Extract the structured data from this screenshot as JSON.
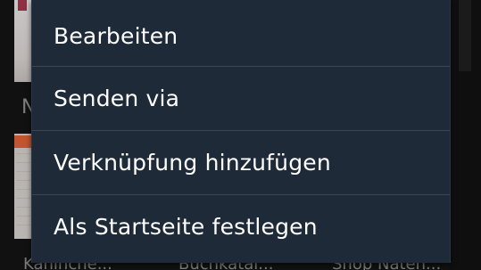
{
  "menu": {
    "items": [
      {
        "label": "Bearbeiten"
      },
      {
        "label": "Senden via"
      },
      {
        "label": "Verknüpfung hinzufügen"
      },
      {
        "label": "Als Startseite festlegen"
      }
    ]
  },
  "background": {
    "letter": "N",
    "captions": [
      "Kaninche...",
      "Buchkatal...",
      "Shop Naten..."
    ]
  }
}
